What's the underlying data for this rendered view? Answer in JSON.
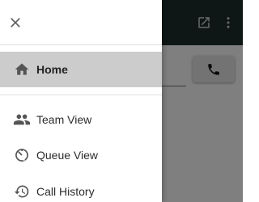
{
  "colors": {
    "app_bar": "#1c2f2a",
    "active_item_bg": "#cccccc",
    "icon_dark": "#555555",
    "scrim": "rgba(0,0,0,0.5)"
  },
  "app_bar": {
    "icons": [
      "open-in-new-icon",
      "more-vert-icon"
    ]
  },
  "call_button": {
    "icon": "phone-icon"
  },
  "drawer": {
    "close_icon": "close-icon",
    "items": [
      {
        "label": "Home",
        "icon": "home-icon",
        "active": true
      },
      {
        "label": "Team View",
        "icon": "team-icon",
        "active": false
      },
      {
        "label": "Queue View",
        "icon": "queue-timer-icon",
        "active": false
      },
      {
        "label": "Call History",
        "icon": "history-icon",
        "active": false
      }
    ]
  }
}
